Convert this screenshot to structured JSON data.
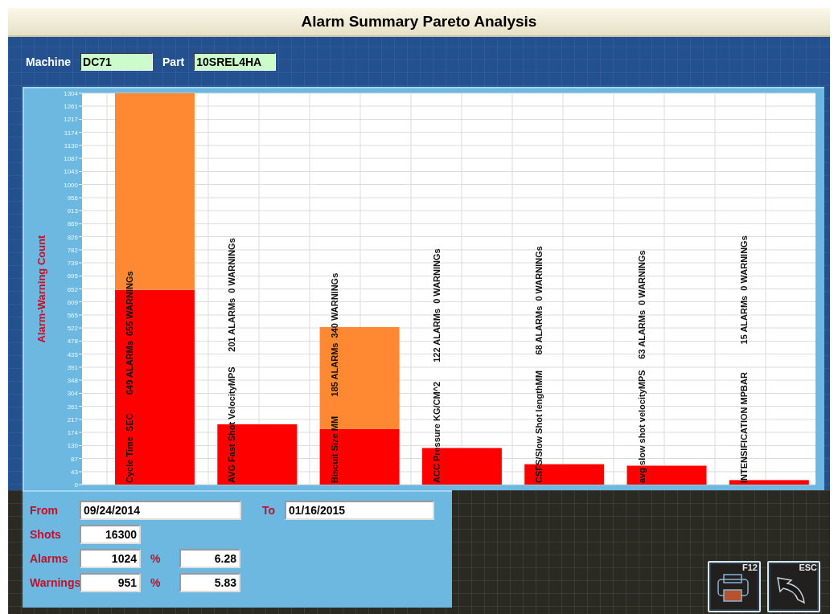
{
  "window": {
    "title": "Alarm Summary Pareto Analysis"
  },
  "filters": [
    {
      "label": "Machine",
      "value": "DC71"
    },
    {
      "label": "Part",
      "value": "10SREL4HA"
    }
  ],
  "chart": {
    "chart_data": {
      "type": "bar",
      "ylabel": "Alarm-Warning Count",
      "stacked": true,
      "grid": true,
      "categories": [
        "Cycle Time  SEC",
        "AVG Fast Shot VelocityMPS",
        "Biscuit Size MM",
        "ACC Pressure KG/CM^2",
        "CSFS/Slow Shot lengthMM",
        "avg slow shot velocityMPS",
        "INTENSIFICATION MPBAR"
      ],
      "series": [
        {
          "color": "#ff0000",
          "values": [
            649,
            201,
            185,
            122,
            68,
            63,
            15
          ]
        },
        {
          "color": "#ff8833",
          "values": [
            655,
            0,
            340,
            0,
            0,
            0,
            0
          ]
        }
      ],
      "value_labels": [
        "649 ALARMs  655 WARNINGs",
        "201 ALARMs  0 WARNINGs",
        "185 ALARMs  340 WARNINGs",
        "122 ALARMs  0 WARNINGs",
        "68 ALARMs  0 WARNINGs",
        "63 ALARMs  0 WARNINGs",
        "15 ALARMs  0 WARNINGs"
      ],
      "ylim": [
        0,
        1304
      ],
      "yticks": [
        0,
        43,
        87,
        130,
        174,
        217,
        261,
        304,
        348,
        391,
        435,
        478,
        522,
        565,
        609,
        652,
        695,
        739,
        782,
        826,
        869,
        913,
        956,
        1000,
        1043,
        1087,
        1130,
        1174,
        1217,
        1261,
        1304
      ]
    }
  },
  "summary": {
    "from": {
      "label": "From",
      "value": "09/24/2014"
    },
    "to": {
      "label": "To",
      "value": "01/16/2015"
    },
    "shots": {
      "label": "Shots",
      "value": "16300"
    },
    "rows": [
      {
        "label": "Alarms",
        "value": "1024",
        "percent_label": "%",
        "percent": "6.28"
      },
      {
        "label": "Warnings",
        "value": "951",
        "percent_label": "%",
        "percent": "5.83"
      }
    ]
  },
  "buttons": [
    {
      "kind": "print",
      "key": "F12"
    },
    {
      "kind": "back",
      "key": "ESC"
    }
  ]
}
